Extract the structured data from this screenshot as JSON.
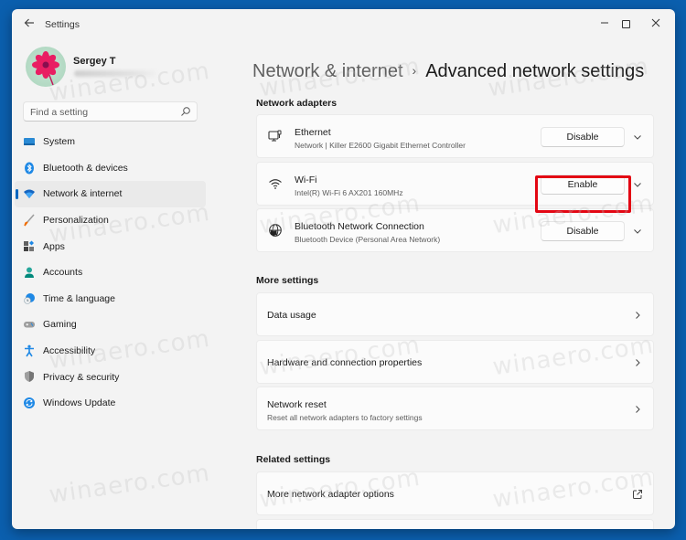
{
  "window": {
    "app_title": "Settings",
    "controls": {
      "minimize": "minimize",
      "maximize": "maximize",
      "close": "close"
    }
  },
  "profile": {
    "name": "Sergey T",
    "email_hidden": true
  },
  "search": {
    "placeholder": "Find a setting",
    "value": ""
  },
  "sidebar": {
    "items": [
      {
        "label": "System",
        "icon": "monitor-icon",
        "active": false
      },
      {
        "label": "Bluetooth & devices",
        "icon": "bluetooth-icon",
        "active": false
      },
      {
        "label": "Network & internet",
        "icon": "wifi-icon",
        "active": true
      },
      {
        "label": "Personalization",
        "icon": "brush-icon",
        "active": false
      },
      {
        "label": "Apps",
        "icon": "apps-icon",
        "active": false
      },
      {
        "label": "Accounts",
        "icon": "person-icon",
        "active": false
      },
      {
        "label": "Time & language",
        "icon": "clock-globe-icon",
        "active": false
      },
      {
        "label": "Gaming",
        "icon": "gamepad-icon",
        "active": false
      },
      {
        "label": "Accessibility",
        "icon": "accessibility-icon",
        "active": false
      },
      {
        "label": "Privacy & security",
        "icon": "shield-icon",
        "active": false
      },
      {
        "label": "Windows Update",
        "icon": "update-icon",
        "active": false
      }
    ]
  },
  "header": {
    "parent": "Network & internet",
    "separator": "›",
    "current": "Advanced network settings"
  },
  "adapters": {
    "section_title": "Network adapters",
    "items": [
      {
        "title": "Ethernet",
        "subtitle": "Network | Killer E2600 Gigabit Ethernet Controller",
        "button": "Disable",
        "icon": "ethernet-icon"
      },
      {
        "title": "Wi-Fi",
        "subtitle": "Intel(R) Wi-Fi 6 AX201 160MHz",
        "button": "Enable",
        "icon": "wifi-icon",
        "highlighted": true
      },
      {
        "title": "Bluetooth Network Connection",
        "subtitle": "Bluetooth Device (Personal Area Network)",
        "button": "Disable",
        "icon": "globe-network-icon"
      }
    ]
  },
  "more_settings": {
    "section_title": "More settings",
    "items": [
      {
        "title": "Data usage"
      },
      {
        "title": "Hardware and connection properties"
      },
      {
        "title": "Network reset",
        "subtitle": "Reset all network adapters to factory settings"
      }
    ]
  },
  "related_settings": {
    "section_title": "Related settings",
    "items": [
      {
        "title": "More network adapter options",
        "icon": "external-link-icon"
      }
    ]
  },
  "watermark": "winaero.com",
  "colors": {
    "accent": "#0067c0",
    "highlight": "#e30613",
    "desktop": "#0b5fae"
  }
}
